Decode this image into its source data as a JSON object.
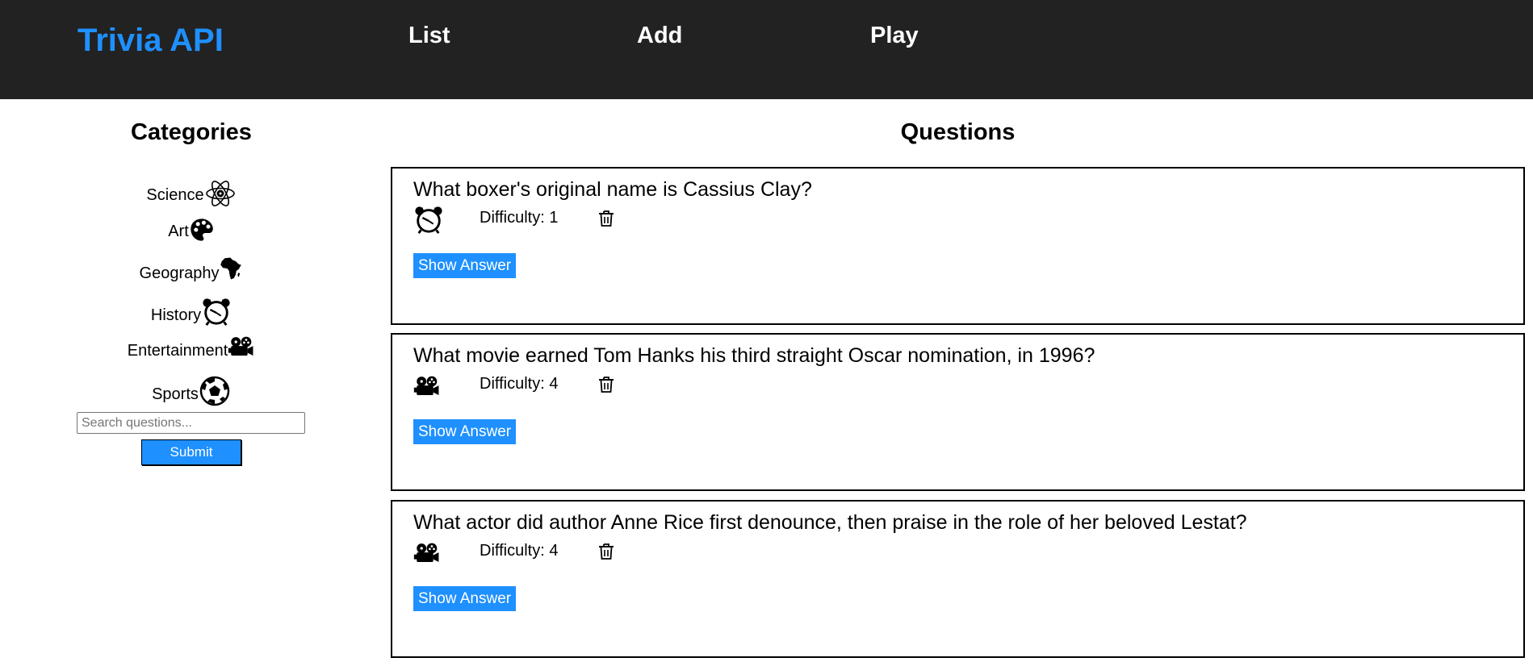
{
  "header": {
    "brand": "Trivia API",
    "nav": [
      "List",
      "Add",
      "Play"
    ]
  },
  "sidebar": {
    "title": "Categories",
    "categories": [
      {
        "label": "Science",
        "icon": "atom-icon"
      },
      {
        "label": "Art",
        "icon": "palette-icon"
      },
      {
        "label": "Geography",
        "icon": "africa-map-icon"
      },
      {
        "label": "History",
        "icon": "alarm-clock-icon"
      },
      {
        "label": "Entertainment",
        "icon": "film-camera-icon"
      },
      {
        "label": "Sports",
        "icon": "soccer-ball-icon"
      }
    ],
    "search_placeholder": "Search questions...",
    "search_value": "",
    "submit_label": "Submit"
  },
  "main": {
    "title": "Questions",
    "questions": [
      {
        "text": "What boxer's original name is Cassius Clay?",
        "category_icon": "alarm-clock-icon",
        "difficulty": "Difficulty: 1",
        "show_answer": "Show Answer"
      },
      {
        "text": "What movie earned Tom Hanks his third straight Oscar nomination, in 1996?",
        "category_icon": "film-camera-icon",
        "difficulty": "Difficulty: 4",
        "show_answer": "Show Answer"
      },
      {
        "text": "What actor did author Anne Rice first denounce, then praise in the role of her beloved Lestat?",
        "category_icon": "film-camera-icon",
        "difficulty": "Difficulty: 4",
        "show_answer": "Show Answer"
      }
    ]
  },
  "colors": {
    "header_bg": "#222222",
    "brand": "#1e90ff",
    "button_bg": "#1e90ff",
    "nav_text": "#ffffff"
  }
}
